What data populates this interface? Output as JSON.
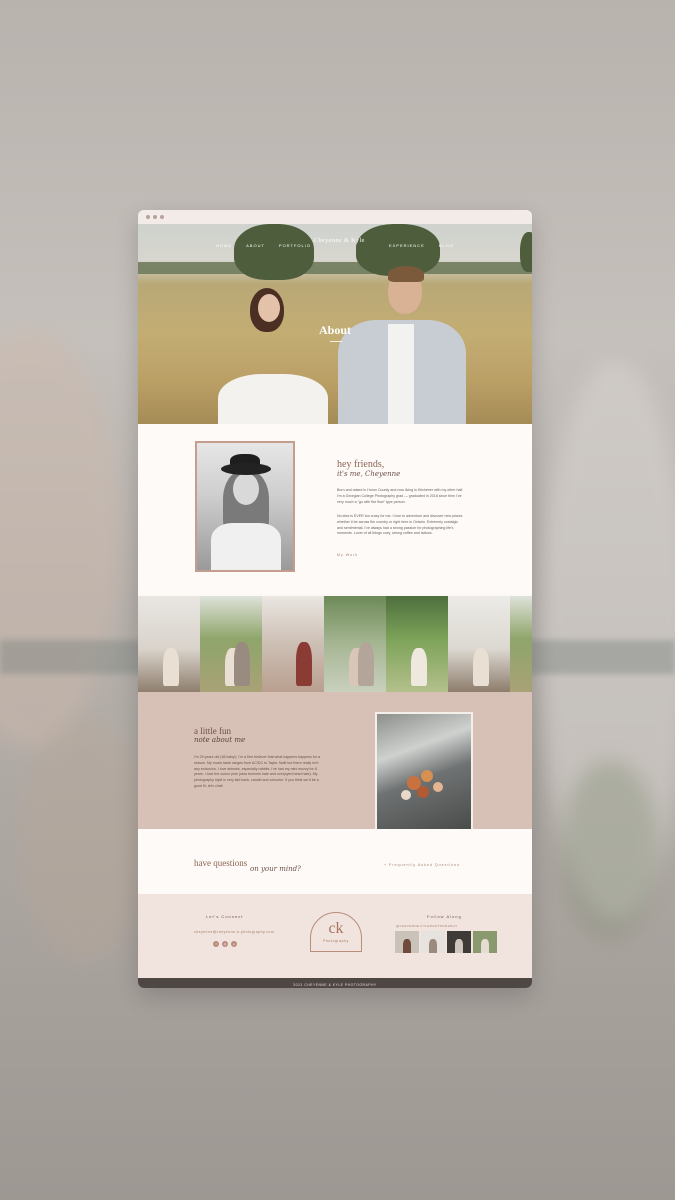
{
  "hero": {
    "nav": [
      "Home",
      "About",
      "Portfolio",
      "Experience",
      "Blog"
    ],
    "logo_text": "Cheyenne & Kyle",
    "title": "About"
  },
  "intro": {
    "greeting": "hey friends,",
    "name_line": "it's me, Cheyenne",
    "paragraph1": "Born and raised in Huron County and now living in Kitchener with my other half. I'm a Georgian College Photography grad — graduated in 2018 since then I've very much a \"go with the flow\" type person.",
    "paragraph2": "No idea is EVER too crazy for me. I love to adventure and discover new places whether it be across the country or right here in Ontario. Extremely nostalgic and sentimental, I've always had a strong passion for photographing life's moments. Lover of all things cozy, strong coffee and tattoos.",
    "more_link": "My Work"
  },
  "facts": {
    "title": "a little fun",
    "subtitle": "note about me",
    "paragraph": "I'm 25 years old (98 baby!). I'm a firm believer that what happens happens for a reason. My music taste ranges from AC/DC to Taylor Swift but there really isn't any exclusion. I love animals, especially rabbits. I've had my mini muzzy for 8 years. I love the colour pink (slow bonnets hate and overjoyed bead hate). My photography style is very laid back, candid and colourful. If you think we'd be a good fit, let's chat!"
  },
  "questions": {
    "line1": "have questions",
    "line2": "on your mind?",
    "faq_link": "+ Frequently Asked Questions"
  },
  "footer": {
    "connect_heading": "Let's Connect",
    "email": "cheyenne@cheyenne-k-photography.com",
    "social_icons": [
      "facebook-icon",
      "instagram-icon",
      "pinterest-icon"
    ],
    "logo_mark": "ck",
    "logo_wordmark": "Photography",
    "follow_heading": "Follow Along",
    "handle": "@CHEYENNE.KYLEPHOTOGRAPHY",
    "bottom_text": "2021 CHEYENNE & KYLE PHOTOGRAPHY"
  },
  "colors": {
    "accent": "#a77f6d",
    "facts_bg": "#d7c1b7",
    "footer_bg": "#f1e3de",
    "bottom_bar": "#4f4744"
  }
}
